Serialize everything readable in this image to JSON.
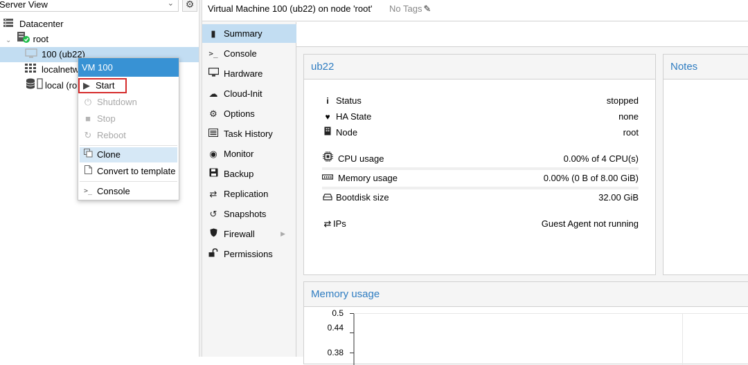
{
  "left_panel": {
    "view_select": "Server View",
    "tree": [
      {
        "label": "Datacenter"
      },
      {
        "label": "root"
      },
      {
        "label": "100 (ub22)"
      },
      {
        "label": "localnetw"
      },
      {
        "label": "local (ro"
      }
    ]
  },
  "context_menu": {
    "header": "VM 100",
    "items": [
      {
        "label": "Start",
        "icon": "play-icon"
      },
      {
        "label": "Shutdown",
        "icon": "power-icon"
      },
      {
        "label": "Stop",
        "icon": "stop-icon"
      },
      {
        "label": "Reboot",
        "icon": "refresh-icon"
      },
      {
        "label": "Clone",
        "icon": "clone-icon"
      },
      {
        "label": "Convert to template",
        "icon": "file-icon"
      },
      {
        "label": "Console",
        "icon": "terminal-icon"
      }
    ]
  },
  "header": {
    "title": "Virtual Machine 100 (ub22) on node 'root'",
    "tags": "No Tags"
  },
  "nav": {
    "items": [
      {
        "label": "Summary",
        "icon": "book-icon"
      },
      {
        "label": "Console",
        "icon": "terminal-icon"
      },
      {
        "label": "Hardware",
        "icon": "desktop-icon"
      },
      {
        "label": "Cloud-Init",
        "icon": "cloud-icon"
      },
      {
        "label": "Options",
        "icon": "gear-icon"
      },
      {
        "label": "Task History",
        "icon": "list-icon"
      },
      {
        "label": "Monitor",
        "icon": "eye-icon"
      },
      {
        "label": "Backup",
        "icon": "floppy-icon"
      },
      {
        "label": "Replication",
        "icon": "retweet-icon"
      },
      {
        "label": "Snapshots",
        "icon": "history-icon"
      },
      {
        "label": "Firewall",
        "icon": "shield-icon"
      },
      {
        "label": "Permissions",
        "icon": "unlock-icon"
      }
    ]
  },
  "summary": {
    "panel_title": "ub22",
    "status_label": "Status",
    "status_value": "stopped",
    "ha_label": "HA State",
    "ha_value": "none",
    "node_label": "Node",
    "node_value": "root",
    "cpu_label": "CPU usage",
    "cpu_value": "0.00% of 4 CPU(s)",
    "mem_label": "Memory usage",
    "mem_value": "0.00% (0 B of 8.00 GiB)",
    "disk_label": "Bootdisk size",
    "disk_value": "32.00 GiB",
    "ips_label": "IPs",
    "ips_value": "Guest Agent not running"
  },
  "notes": {
    "title": "Notes"
  },
  "memory_chart": {
    "title": "Memory usage",
    "y_ticks": [
      "0.5",
      "0.44",
      "0.38"
    ]
  },
  "colors": {
    "accent": "#3892d4",
    "selected": "#c2ddf2",
    "panel_title": "#2e7cc1",
    "highlight_box": "#d52b2b"
  }
}
